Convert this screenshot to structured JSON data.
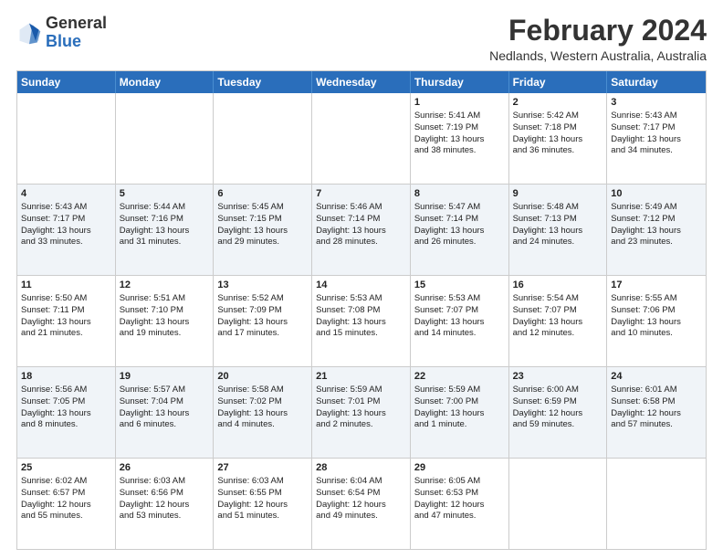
{
  "header": {
    "logo": {
      "line1": "General",
      "line2": "Blue"
    },
    "title": "February 2024",
    "location": "Nedlands, Western Australia, Australia"
  },
  "days": [
    "Sunday",
    "Monday",
    "Tuesday",
    "Wednesday",
    "Thursday",
    "Friday",
    "Saturday"
  ],
  "rows": [
    [
      {
        "num": "",
        "lines": []
      },
      {
        "num": "",
        "lines": []
      },
      {
        "num": "",
        "lines": []
      },
      {
        "num": "",
        "lines": []
      },
      {
        "num": "1",
        "lines": [
          "Sunrise: 5:41 AM",
          "Sunset: 7:19 PM",
          "Daylight: 13 hours",
          "and 38 minutes."
        ]
      },
      {
        "num": "2",
        "lines": [
          "Sunrise: 5:42 AM",
          "Sunset: 7:18 PM",
          "Daylight: 13 hours",
          "and 36 minutes."
        ]
      },
      {
        "num": "3",
        "lines": [
          "Sunrise: 5:43 AM",
          "Sunset: 7:17 PM",
          "Daylight: 13 hours",
          "and 34 minutes."
        ]
      }
    ],
    [
      {
        "num": "4",
        "lines": [
          "Sunrise: 5:43 AM",
          "Sunset: 7:17 PM",
          "Daylight: 13 hours",
          "and 33 minutes."
        ]
      },
      {
        "num": "5",
        "lines": [
          "Sunrise: 5:44 AM",
          "Sunset: 7:16 PM",
          "Daylight: 13 hours",
          "and 31 minutes."
        ]
      },
      {
        "num": "6",
        "lines": [
          "Sunrise: 5:45 AM",
          "Sunset: 7:15 PM",
          "Daylight: 13 hours",
          "and 29 minutes."
        ]
      },
      {
        "num": "7",
        "lines": [
          "Sunrise: 5:46 AM",
          "Sunset: 7:14 PM",
          "Daylight: 13 hours",
          "and 28 minutes."
        ]
      },
      {
        "num": "8",
        "lines": [
          "Sunrise: 5:47 AM",
          "Sunset: 7:14 PM",
          "Daylight: 13 hours",
          "and 26 minutes."
        ]
      },
      {
        "num": "9",
        "lines": [
          "Sunrise: 5:48 AM",
          "Sunset: 7:13 PM",
          "Daylight: 13 hours",
          "and 24 minutes."
        ]
      },
      {
        "num": "10",
        "lines": [
          "Sunrise: 5:49 AM",
          "Sunset: 7:12 PM",
          "Daylight: 13 hours",
          "and 23 minutes."
        ]
      }
    ],
    [
      {
        "num": "11",
        "lines": [
          "Sunrise: 5:50 AM",
          "Sunset: 7:11 PM",
          "Daylight: 13 hours",
          "and 21 minutes."
        ]
      },
      {
        "num": "12",
        "lines": [
          "Sunrise: 5:51 AM",
          "Sunset: 7:10 PM",
          "Daylight: 13 hours",
          "and 19 minutes."
        ]
      },
      {
        "num": "13",
        "lines": [
          "Sunrise: 5:52 AM",
          "Sunset: 7:09 PM",
          "Daylight: 13 hours",
          "and 17 minutes."
        ]
      },
      {
        "num": "14",
        "lines": [
          "Sunrise: 5:53 AM",
          "Sunset: 7:08 PM",
          "Daylight: 13 hours",
          "and 15 minutes."
        ]
      },
      {
        "num": "15",
        "lines": [
          "Sunrise: 5:53 AM",
          "Sunset: 7:07 PM",
          "Daylight: 13 hours",
          "and 14 minutes."
        ]
      },
      {
        "num": "16",
        "lines": [
          "Sunrise: 5:54 AM",
          "Sunset: 7:07 PM",
          "Daylight: 13 hours",
          "and 12 minutes."
        ]
      },
      {
        "num": "17",
        "lines": [
          "Sunrise: 5:55 AM",
          "Sunset: 7:06 PM",
          "Daylight: 13 hours",
          "and 10 minutes."
        ]
      }
    ],
    [
      {
        "num": "18",
        "lines": [
          "Sunrise: 5:56 AM",
          "Sunset: 7:05 PM",
          "Daylight: 13 hours",
          "and 8 minutes."
        ]
      },
      {
        "num": "19",
        "lines": [
          "Sunrise: 5:57 AM",
          "Sunset: 7:04 PM",
          "Daylight: 13 hours",
          "and 6 minutes."
        ]
      },
      {
        "num": "20",
        "lines": [
          "Sunrise: 5:58 AM",
          "Sunset: 7:02 PM",
          "Daylight: 13 hours",
          "and 4 minutes."
        ]
      },
      {
        "num": "21",
        "lines": [
          "Sunrise: 5:59 AM",
          "Sunset: 7:01 PM",
          "Daylight: 13 hours",
          "and 2 minutes."
        ]
      },
      {
        "num": "22",
        "lines": [
          "Sunrise: 5:59 AM",
          "Sunset: 7:00 PM",
          "Daylight: 13 hours",
          "and 1 minute."
        ]
      },
      {
        "num": "23",
        "lines": [
          "Sunrise: 6:00 AM",
          "Sunset: 6:59 PM",
          "Daylight: 12 hours",
          "and 59 minutes."
        ]
      },
      {
        "num": "24",
        "lines": [
          "Sunrise: 6:01 AM",
          "Sunset: 6:58 PM",
          "Daylight: 12 hours",
          "and 57 minutes."
        ]
      }
    ],
    [
      {
        "num": "25",
        "lines": [
          "Sunrise: 6:02 AM",
          "Sunset: 6:57 PM",
          "Daylight: 12 hours",
          "and 55 minutes."
        ]
      },
      {
        "num": "26",
        "lines": [
          "Sunrise: 6:03 AM",
          "Sunset: 6:56 PM",
          "Daylight: 12 hours",
          "and 53 minutes."
        ]
      },
      {
        "num": "27",
        "lines": [
          "Sunrise: 6:03 AM",
          "Sunset: 6:55 PM",
          "Daylight: 12 hours",
          "and 51 minutes."
        ]
      },
      {
        "num": "28",
        "lines": [
          "Sunrise: 6:04 AM",
          "Sunset: 6:54 PM",
          "Daylight: 12 hours",
          "and 49 minutes."
        ]
      },
      {
        "num": "29",
        "lines": [
          "Sunrise: 6:05 AM",
          "Sunset: 6:53 PM",
          "Daylight: 12 hours",
          "and 47 minutes."
        ]
      },
      {
        "num": "",
        "lines": []
      },
      {
        "num": "",
        "lines": []
      }
    ]
  ]
}
